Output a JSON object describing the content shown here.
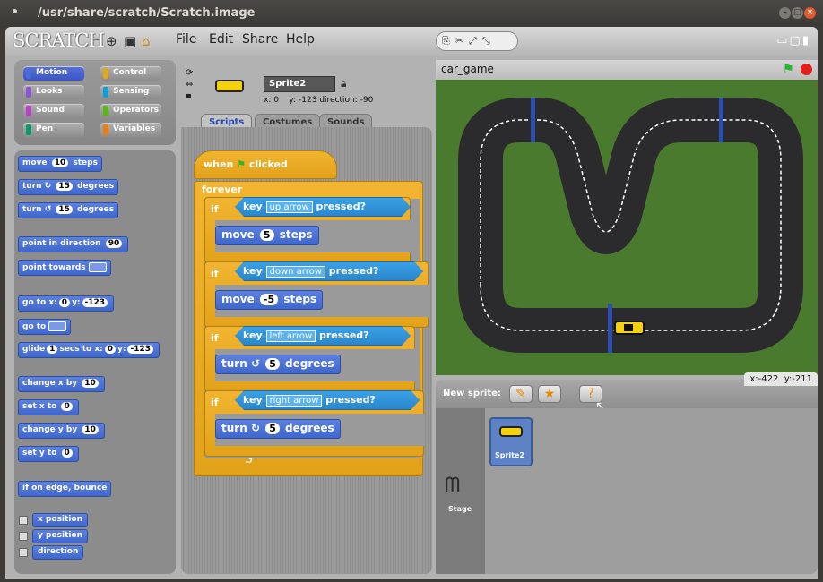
{
  "window": {
    "title": "/usr/share/scratch/Scratch.image"
  },
  "menu": {
    "logo": "SCRATCH",
    "file": "File",
    "edit": "Edit",
    "share": "Share",
    "help": "Help"
  },
  "categories": [
    {
      "label": "Motion",
      "color": "#4a6cd4",
      "selected": true
    },
    {
      "label": "Control",
      "color": "#e1a91a"
    },
    {
      "label": "Looks",
      "color": "#8a55d7"
    },
    {
      "label": "Sensing",
      "color": "#0ca0d8"
    },
    {
      "label": "Sound",
      "color": "#bb42c3"
    },
    {
      "label": "Operators",
      "color": "#5cb712"
    },
    {
      "label": "Pen",
      "color": "#0e9a6c"
    },
    {
      "label": "Variables",
      "color": "#ee7d16"
    }
  ],
  "palette": {
    "move": {
      "pre": "move",
      "n": "10",
      "post": "steps"
    },
    "turn_cw": {
      "pre": "turn",
      "n": "15",
      "post": "degrees"
    },
    "turn_ccw": {
      "pre": "turn",
      "n": "15",
      "post": "degrees"
    },
    "point_dir": {
      "pre": "point in direction",
      "n": "90"
    },
    "point_towards": {
      "pre": "point towards"
    },
    "goto_xy": {
      "pre": "go to x:",
      "x": "0",
      "mid": "y:",
      "y": "-123"
    },
    "goto": {
      "pre": "go to"
    },
    "glide": {
      "pre": "glide",
      "s": "1",
      "mid": "secs to x:",
      "x": "0",
      "mid2": "y:",
      "y": "-123"
    },
    "change_x": {
      "pre": "change x by",
      "n": "10"
    },
    "set_x": {
      "pre": "set x to",
      "n": "0"
    },
    "change_y": {
      "pre": "change y by",
      "n": "10"
    },
    "set_y": {
      "pre": "set y to",
      "n": "0"
    },
    "bounce": "if on edge, bounce",
    "xpos": "x position",
    "ypos": "y position",
    "direction": "direction"
  },
  "sprite": {
    "name": "Sprite2",
    "x_label": "x:",
    "x": "0",
    "y_label": "y:",
    "y": "-123",
    "dir_label": "direction:",
    "dir": "-90"
  },
  "tabs": [
    "Scripts",
    "Costumes",
    "Sounds"
  ],
  "script": {
    "hat": {
      "when": "when",
      "clicked": "clicked"
    },
    "forever": "forever",
    "if_label": "if",
    "key": "key",
    "pressed": "pressed?",
    "blocks": [
      {
        "key": "up arrow",
        "action": "move",
        "n": "5",
        "unit": "steps"
      },
      {
        "key": "down arrow",
        "action": "move",
        "n": "-5",
        "unit": "steps"
      },
      {
        "key": "left arrow",
        "action": "turn",
        "n": "5",
        "unit": "degrees"
      },
      {
        "key": "right arrow",
        "action": "turn",
        "n": "5",
        "unit": "degrees"
      }
    ]
  },
  "stage": {
    "title": "car_game",
    "x_label": "x:",
    "x": "-422",
    "y_label": "y:",
    "y": "-211"
  },
  "newsprite": {
    "label": "New sprite:"
  },
  "spritelist": {
    "sprite": "Sprite2",
    "stage": "Stage"
  }
}
